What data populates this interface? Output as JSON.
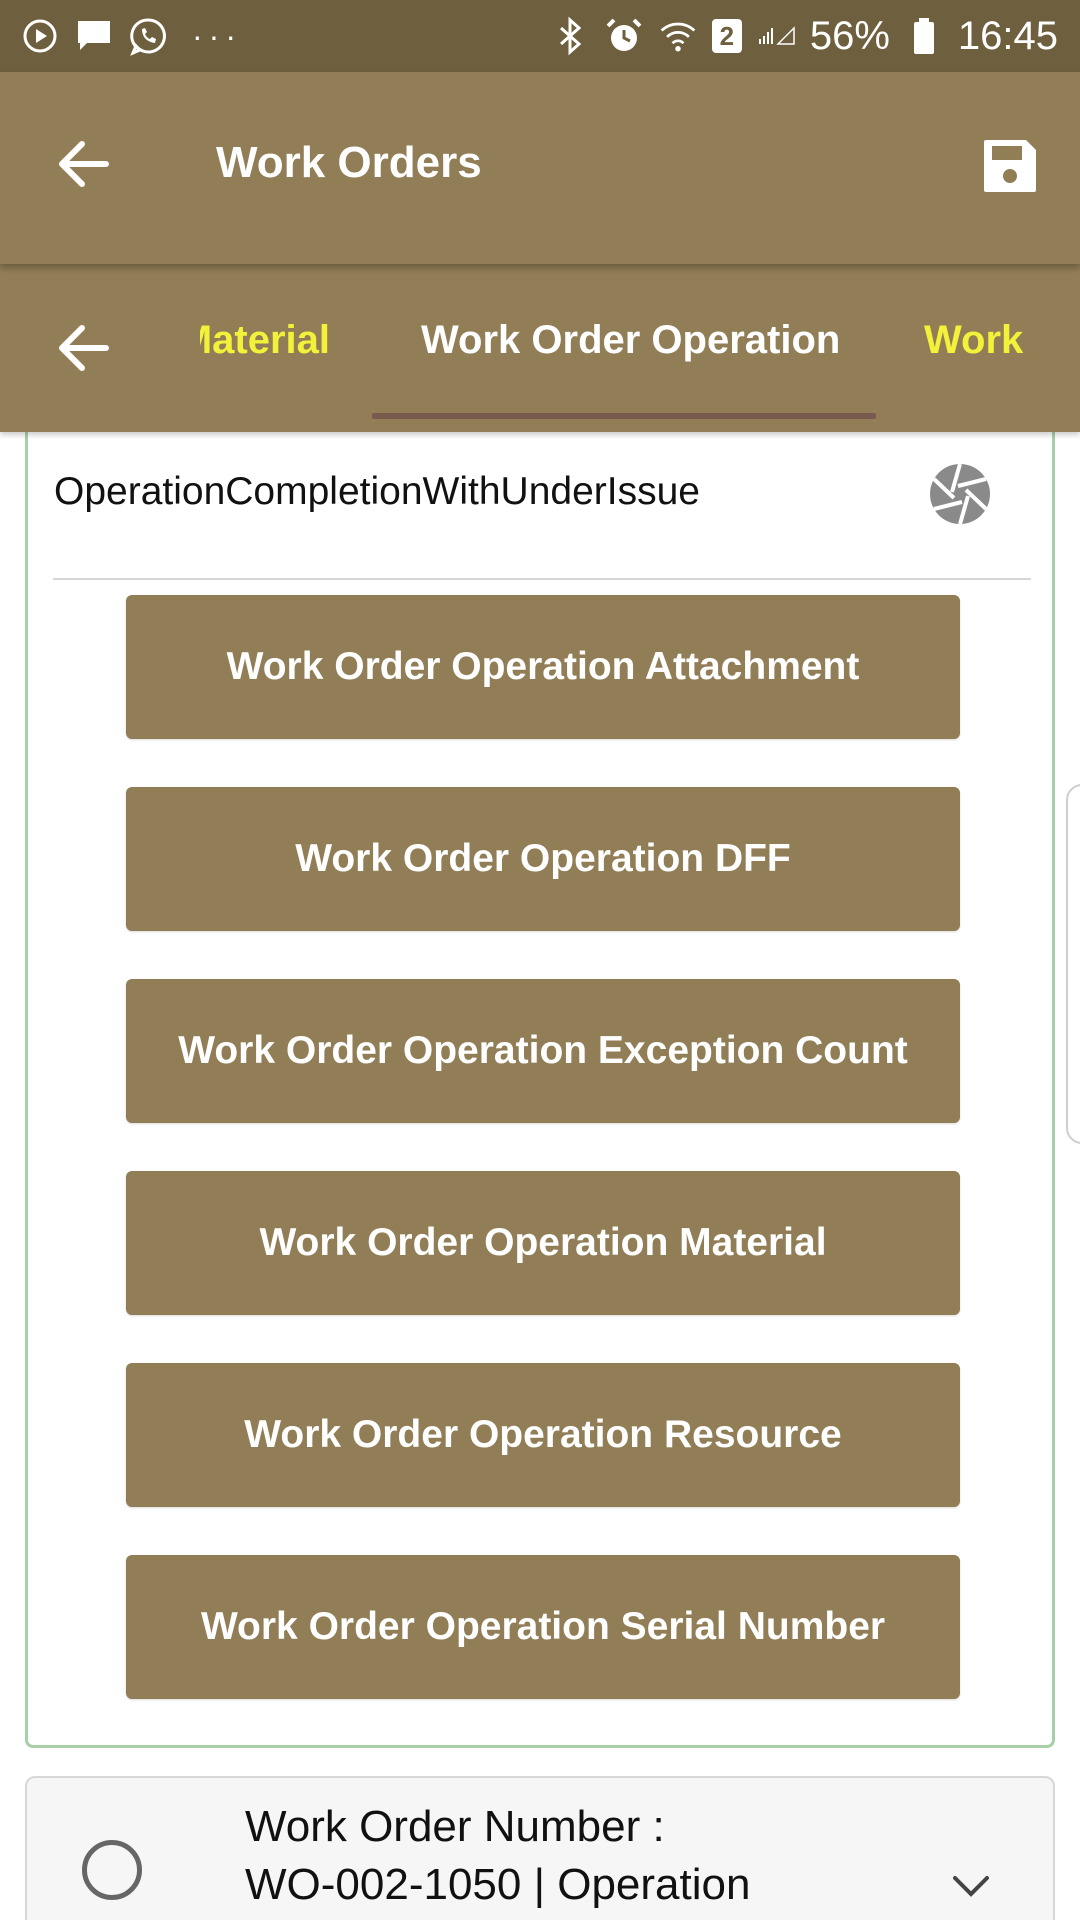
{
  "status_bar": {
    "battery": "56%",
    "time": "16:45",
    "notification_badge": "2",
    "icons": [
      "play-icon",
      "message-icon",
      "whatsapp-icon",
      "more-icon",
      "bluetooth-icon",
      "alarm-icon",
      "wifi-icon",
      "signal-icon",
      "battery-icon"
    ]
  },
  "app_bar": {
    "title": "Work Orders"
  },
  "tabs": {
    "items": [
      {
        "label": "Material"
      },
      {
        "label": "Work Order Operation"
      },
      {
        "label": "Work"
      }
    ],
    "active_label": "Work Order Operation"
  },
  "operation": {
    "title": "OperationCompletionWithUnderIssue"
  },
  "actions": [
    {
      "label": "Work Order Operation Attachment"
    },
    {
      "label": "Work Order Operation DFF"
    },
    {
      "label": "Work Order Operation Exception Count"
    },
    {
      "label": "Work Order Operation Material"
    },
    {
      "label": "Work Order Operation Resource"
    },
    {
      "label": "Work Order Operation Serial Number"
    }
  ],
  "next_item": {
    "line1": "Work Order Number :",
    "line2": "WO-002-1050 | Operation"
  },
  "colors": {
    "status_bar": "#6e5f3e",
    "primary": "#917d56",
    "tab_inactive": "#f2f23a",
    "tab_indicator": "#7a5a4c",
    "card_border": "#a8cfa8"
  }
}
